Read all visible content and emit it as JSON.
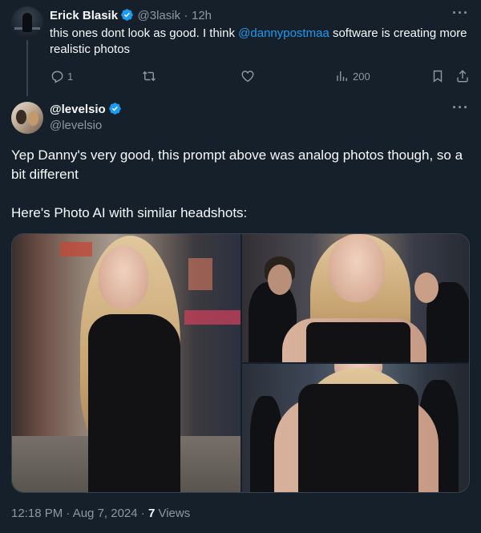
{
  "reply": {
    "author_name": "Erick Blasik",
    "author_handle": "@3lasik",
    "separator": "·",
    "time": "12h",
    "text_before": "this ones dont look as good. I think ",
    "mention": "@dannypostmaa",
    "text_after": " software is creating more realistic photos",
    "reply_count": "1",
    "views_count": "200"
  },
  "main": {
    "author_name": "@levelsio",
    "author_handle": "@levelsio",
    "paragraph_1": "Yep Danny's very good, this prompt above was analog photos though, so a bit different",
    "paragraph_2": "Here's Photo AI with similar headshots:",
    "timestamp": "12:18 PM · Aug 7, 2024 · ",
    "views_count": "7",
    "views_label": " Views"
  },
  "more_label": "···",
  "colors": {
    "background": "#15202b",
    "text": "#f7f9f9",
    "muted": "#8b98a5",
    "accent": "#1d9bf0"
  },
  "icons": [
    "verified-badge-icon",
    "more-icon",
    "reply-icon",
    "retweet-icon",
    "like-icon",
    "views-icon",
    "bookmark-icon",
    "share-icon"
  ]
}
